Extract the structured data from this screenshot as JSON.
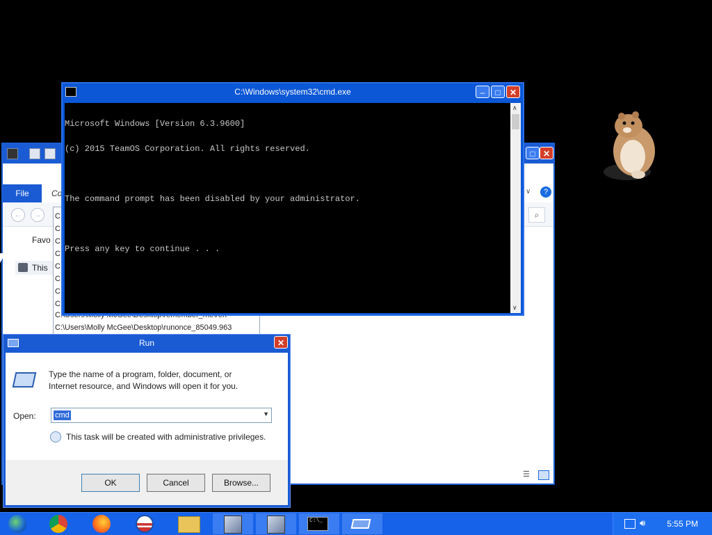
{
  "explorer": {
    "file_tab": "File",
    "ribbon_tab_partial": "Co",
    "favorites_partial": "Favo",
    "this_pc_partial": "This",
    "address_history": [
      "C:",
      "C:",
      "C:",
      "C:",
      "C:",
      "C:",
      "C:",
      "C:",
      "C:\\Users\\Molly McGee\\Desktop\\remember_me\\ren",
      "C:\\Users\\Molly McGee\\Desktop\\runonce_85049.963"
    ]
  },
  "cmd": {
    "title": "C:\\Windows\\system32\\cmd.exe",
    "lines": [
      "Microsoft Windows [Version 6.3.9600]",
      "(c) 2015 TeamOS Corporation. All rights reserved.",
      "",
      "The command prompt has been disabled by your administrator.",
      "",
      "Press any key to continue . . ."
    ]
  },
  "run": {
    "title": "Run",
    "description_line1": "Type the name of a program, folder, document, or",
    "description_line2": "Internet resource, and Windows will open it for you.",
    "open_label": "Open:",
    "open_value": "cmd",
    "admin_note": "This task will be created with administrative privileges.",
    "ok_label": "OK",
    "cancel_label": "Cancel",
    "browse_label": "Browse..."
  },
  "taskbar": {
    "apps": [
      "windows-orb",
      "chrome",
      "firefox",
      "obama-logo",
      "file-explorer",
      "setup-installer",
      "setup-installer",
      "cmd",
      "run"
    ],
    "clock": "5:55 PM"
  }
}
